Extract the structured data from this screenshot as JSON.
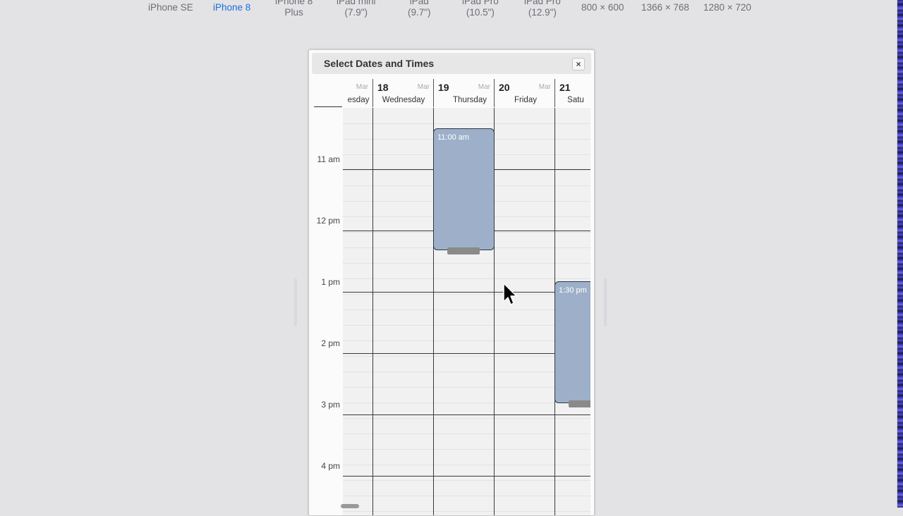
{
  "device_bar": {
    "devices": [
      {
        "line1": "iPhone SE",
        "line2": ""
      },
      {
        "line1": "iPhone 8",
        "line2": ""
      },
      {
        "line1": "iPhone 8",
        "line2": "Plus"
      },
      {
        "line1": "iPad mini",
        "line2": "(7.9\")"
      },
      {
        "line1": "iPad",
        "line2": "(9.7\")"
      },
      {
        "line1": "iPad Pro",
        "line2": "(10.5\")"
      },
      {
        "line1": "iPad Pro",
        "line2": "(12.9\")"
      },
      {
        "line1": "800 × 600",
        "line2": ""
      },
      {
        "line1": "1366 × 768",
        "line2": ""
      },
      {
        "line1": "1280 × 720",
        "line2": ""
      }
    ],
    "selected": "iPhone 8",
    "accent_color": "#1a6fd6"
  },
  "dialog": {
    "title": "Select Dates and Times",
    "close_icon": "×",
    "days": [
      {
        "month": "Mar",
        "num": "",
        "weekday": "esday"
      },
      {
        "month": "Mar",
        "num": "18",
        "weekday": "Wednesday"
      },
      {
        "month": "Mar",
        "num": "19",
        "weekday": "Thursday"
      },
      {
        "month": "Mar",
        "num": "20",
        "weekday": "Friday"
      },
      {
        "month": "",
        "num": "21",
        "weekday": "Satu"
      }
    ],
    "time_labels": [
      "11 am",
      "12 pm",
      "1 pm",
      "2 pm",
      "3 pm",
      "4 pm"
    ],
    "events": [
      {
        "time": "11:00 am",
        "day": "Thursday",
        "color": "#9eb0c9"
      },
      {
        "time": "1:30 pm",
        "day": "Saturday",
        "color": "#9eb0c9"
      }
    ]
  }
}
